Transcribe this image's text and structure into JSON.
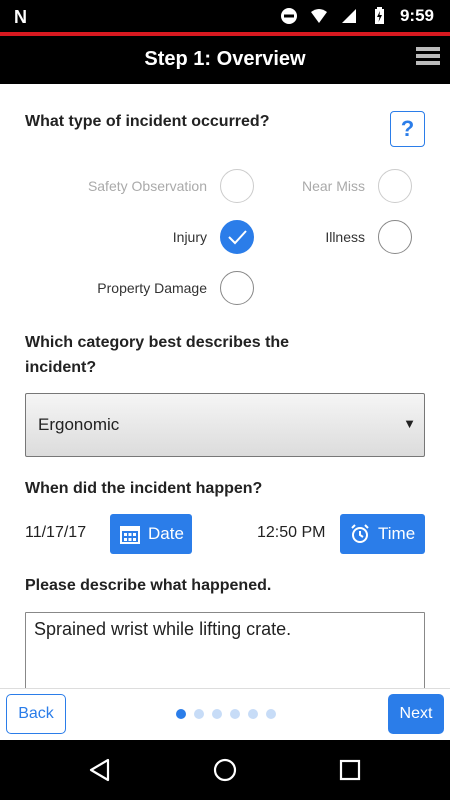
{
  "status_bar": {
    "time": "9:59",
    "icons": [
      "notification-n-icon",
      "do-not-disturb-icon",
      "wifi-icon",
      "signal-icon",
      "battery-charging-icon"
    ]
  },
  "app_bar": {
    "title": "Step 1: Overview",
    "menu_icon": "hamburger-menu-icon"
  },
  "incident_type": {
    "question": "What type of incident occurred?",
    "help_label": "?",
    "options": [
      {
        "label": "Safety Observation",
        "checked": false,
        "disabled": true
      },
      {
        "label": "Near Miss",
        "checked": false,
        "disabled": true
      },
      {
        "label": "Injury",
        "checked": true,
        "disabled": false
      },
      {
        "label": "Illness",
        "checked": false,
        "disabled": false
      },
      {
        "label": "Property Damage",
        "checked": false,
        "disabled": false
      }
    ]
  },
  "category": {
    "question_line1": "Which category best describes the",
    "question_line2": "incident?",
    "selected": "Ergonomic",
    "arrow": "▼"
  },
  "when": {
    "question": "When did the incident happen?",
    "date_value": "11/17/17",
    "date_button": "Date",
    "time_value": "12:50 PM",
    "time_button": "Time"
  },
  "description": {
    "question": "Please describe what happened.",
    "value": "Sprained wrist while lifting crate."
  },
  "footer": {
    "back_label": "Back",
    "next_label": "Next",
    "pages": 6,
    "current_page": 1
  },
  "colors": {
    "accent": "#2b7de9",
    "brand_red": "#d71920",
    "bar": "#000000"
  }
}
